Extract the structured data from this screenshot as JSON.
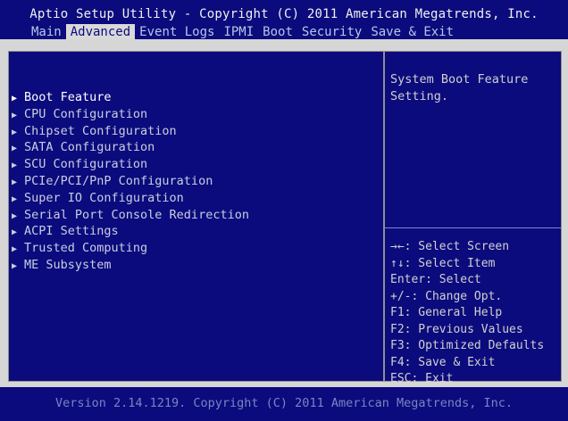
{
  "header": {
    "title": "Aptio Setup Utility - Copyright (C) 2011 American Megatrends, Inc.",
    "tabs": [
      {
        "label": "Main"
      },
      {
        "label": "Advanced",
        "active": true
      },
      {
        "label": "Event Logs"
      },
      {
        "label": "IPMI"
      },
      {
        "label": "Boot"
      },
      {
        "label": "Security"
      },
      {
        "label": "Save & Exit"
      }
    ]
  },
  "menu": {
    "items": [
      {
        "label": "Boot Feature",
        "selected": true
      },
      {
        "label": "CPU Configuration"
      },
      {
        "label": "Chipset Configuration"
      },
      {
        "label": "SATA Configuration"
      },
      {
        "label": "SCU Configuration"
      },
      {
        "label": "PCIe/PCI/PnP Configuration"
      },
      {
        "label": "Super IO Configuration"
      },
      {
        "label": "Serial Port Console Redirection"
      },
      {
        "label": "ACPI Settings"
      },
      {
        "label": "Trusted Computing"
      },
      {
        "label": "ME Subsystem"
      }
    ],
    "arrow_icon": "right-triangle-icon"
  },
  "help": {
    "description_line1": "System Boot Feature",
    "description_line2": "Setting.",
    "keys": [
      "→←: Select Screen",
      "↑↓: Select Item",
      "Enter: Select",
      "+/-: Change Opt.",
      "F1: General Help",
      "F2: Previous Values",
      "F3: Optimized Defaults",
      "F4: Save & Exit",
      "ESC: Exit"
    ]
  },
  "footer": {
    "version": "Version 2.14.1219. Copyright (C) 2011 American Megatrends, Inc."
  },
  "colors": {
    "background": "#0b0b7d",
    "frame": "#d6d6d6",
    "active_tab_bg": "#d9d9d9"
  }
}
